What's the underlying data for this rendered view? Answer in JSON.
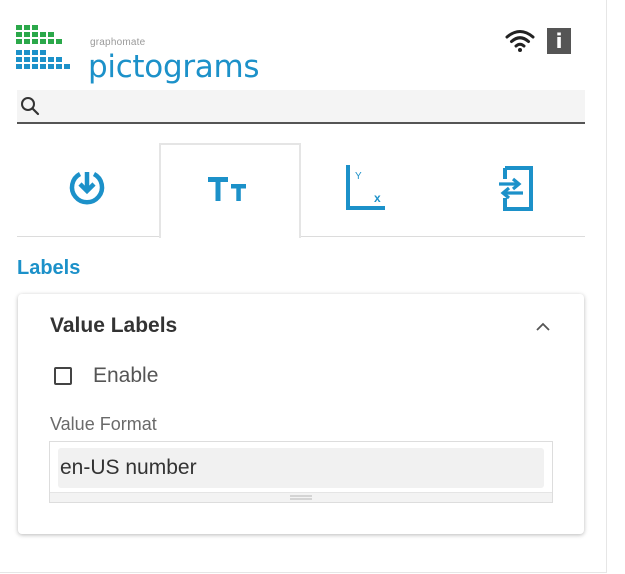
{
  "logo": {
    "company": "graphomate",
    "product": "pictograms",
    "mark_colors": [
      "#2ba84a",
      "#1c91c9"
    ]
  },
  "header": {
    "connection_icon": "wifi-icon",
    "info_label": "i"
  },
  "search": {
    "icon": "search-icon",
    "placeholder": "",
    "value": ""
  },
  "tabs": [
    {
      "icon": "data-refresh-icon",
      "active": false
    },
    {
      "icon": "text-typography-icon",
      "active": true
    },
    {
      "icon": "axis-xy-icon",
      "active": false
    },
    {
      "icon": "import-export-icon",
      "active": false
    }
  ],
  "section": {
    "title": "Labels"
  },
  "card": {
    "title": "Value Labels",
    "collapse_icon": "chevron-up-icon",
    "enable": {
      "label": "Enable",
      "checked": false
    },
    "value_format": {
      "label": "Value Format",
      "value": "en-US number"
    }
  },
  "colors": {
    "accent": "#1c91c9",
    "text": "#333333",
    "muted": "#6a6a6a"
  }
}
